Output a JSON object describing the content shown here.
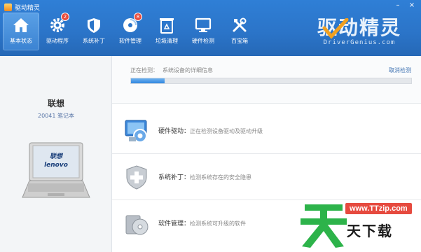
{
  "app": {
    "title": "驱动精灵",
    "brand_cn": "驱动精灵",
    "brand_en": "DriverGenius.com"
  },
  "window_controls": {
    "minimize": "–",
    "close": "×"
  },
  "toolbar": [
    {
      "label": "基本状态",
      "icon": "home-icon",
      "active": true,
      "badge": ""
    },
    {
      "label": "驱动程序",
      "icon": "gear-icon",
      "active": false,
      "badge": "2"
    },
    {
      "label": "系统补丁",
      "icon": "shield-icon",
      "active": false,
      "badge": ""
    },
    {
      "label": "软件管理",
      "icon": "disc-icon",
      "active": false,
      "badge": "8"
    },
    {
      "label": "垃圾清理",
      "icon": "recycle-icon",
      "active": false,
      "badge": ""
    },
    {
      "label": "硬件检测",
      "icon": "monitor-icon",
      "active": false,
      "badge": ""
    },
    {
      "label": "百宝箱",
      "icon": "tools-icon",
      "active": false,
      "badge": ""
    }
  ],
  "device": {
    "name": "联想",
    "model": "20041 笔记本",
    "screen_text_1": "联想",
    "screen_text_2": "lenovo"
  },
  "scan": {
    "status_label": "正在检测：",
    "status_detail": "系统设备的详细信息",
    "cancel": "取消检测",
    "progress_percent": 12
  },
  "tasks": [
    {
      "title": "硬件驱动：",
      "desc": "正在检测设备驱动及驱动升级",
      "icon": "hardware-driver-icon"
    },
    {
      "title": "系统补丁：",
      "desc": "检测系统存在的安全隐患",
      "icon": "shield-plus-icon"
    },
    {
      "title": "软件管理：",
      "desc": "检测系统可升级的软件",
      "icon": "software-disc-icon"
    }
  ],
  "watermark": {
    "url": "www.TTzip.com",
    "text": "天下载"
  },
  "colors": {
    "toolbar_blue": "#2b74c8",
    "progress_blue": "#2f86df",
    "badge_red": "#e84b3c",
    "watermark_green": "#2db34a"
  }
}
